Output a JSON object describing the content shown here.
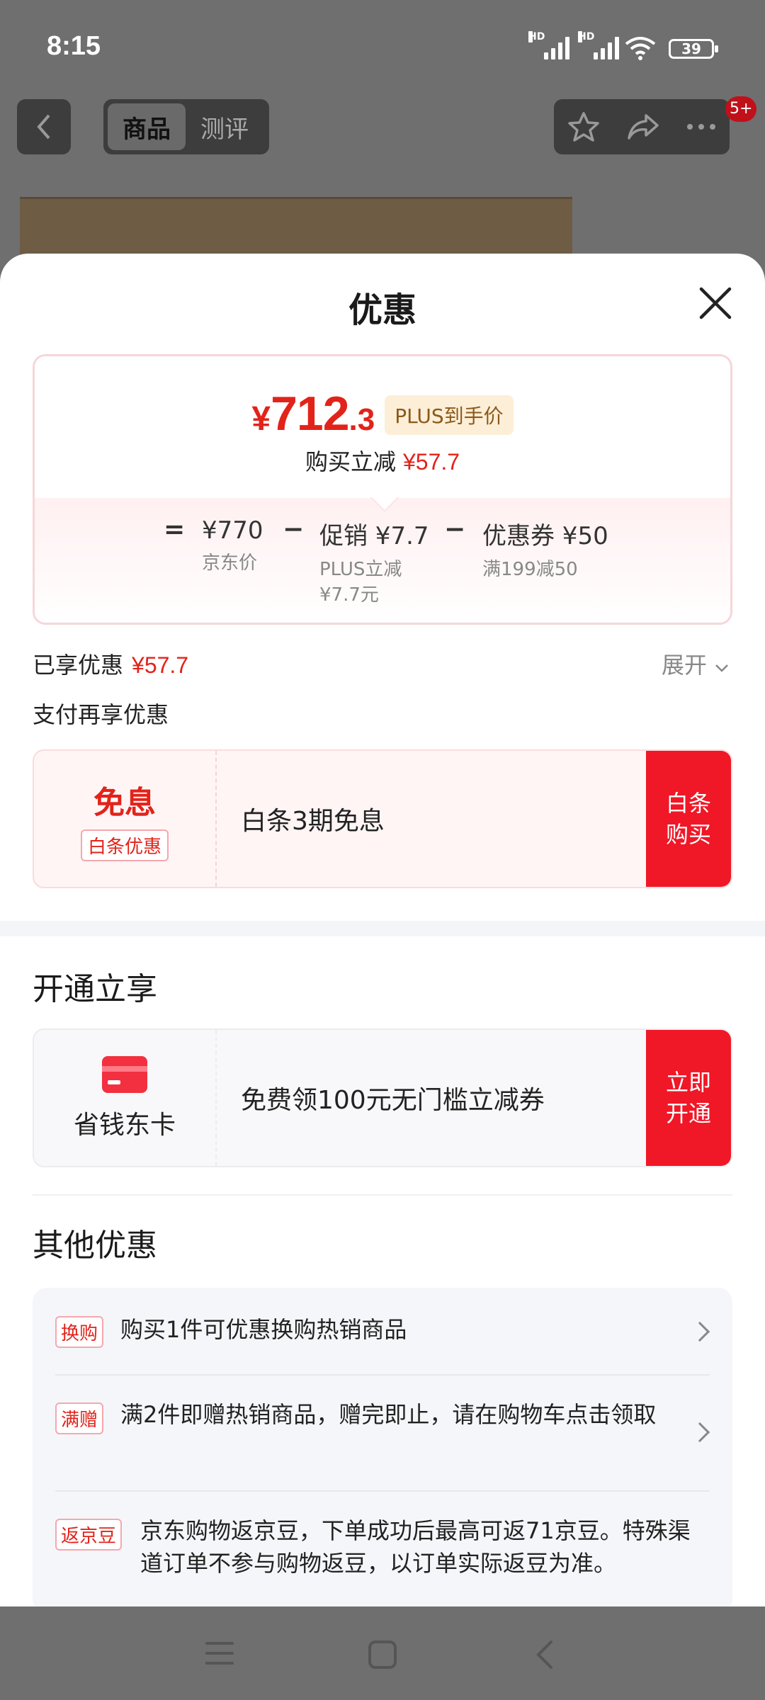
{
  "status_bar": {
    "time": "8:15",
    "battery": "39",
    "signal_label": "HD"
  },
  "top_nav": {
    "tabs": [
      {
        "label": "商品"
      },
      {
        "label": "测评"
      }
    ],
    "cart_badge": "5+"
  },
  "sheet": {
    "title": "优惠",
    "price": {
      "currency": "¥",
      "integer": "712",
      "decimal": ".3",
      "tag": "PLUS到手价",
      "reduce_label": "购买立减",
      "reduce_value": "¥57.7"
    },
    "formula": {
      "equals": "=",
      "minus": "−",
      "items": [
        {
          "main": "¥770",
          "sub": "京东价"
        },
        {
          "main": "促销 ¥7.7",
          "sub": "PLUS立减\n¥7.7元"
        },
        {
          "main": "优惠券 ¥50",
          "sub": "满199减50"
        }
      ]
    },
    "enjoyed": {
      "label": "已享优惠",
      "value": "¥57.7",
      "expand": "展开"
    },
    "pay_more": "支付再享优惠",
    "baitiao_card": {
      "title": "免息",
      "tag": "白条优惠",
      "text": "白条3期免息",
      "button": "白条\n购买"
    },
    "open_section": {
      "title": "开通立享",
      "card": {
        "name": "省钱东卡",
        "text": "免费领100元无门槛立减券",
        "button": "立即\n开通"
      }
    },
    "other_section": {
      "title": "其他优惠",
      "items": [
        {
          "tag": "换购",
          "text": "购买1件可优惠换购热销商品"
        },
        {
          "tag": "满赠",
          "text": "满2件即赠热销商品，赠完即止，请在购物车点击领取"
        },
        {
          "tag": "返京豆",
          "text": "京东购物返京豆，下单成功后最高可返71京豆。特殊渠道订单不参与购物返豆，以订单实际返豆为准。"
        }
      ]
    }
  },
  "colors": {
    "accent": "#e2231a",
    "button_red": "#f01727",
    "plus_tag_bg": "#fdeed7"
  }
}
